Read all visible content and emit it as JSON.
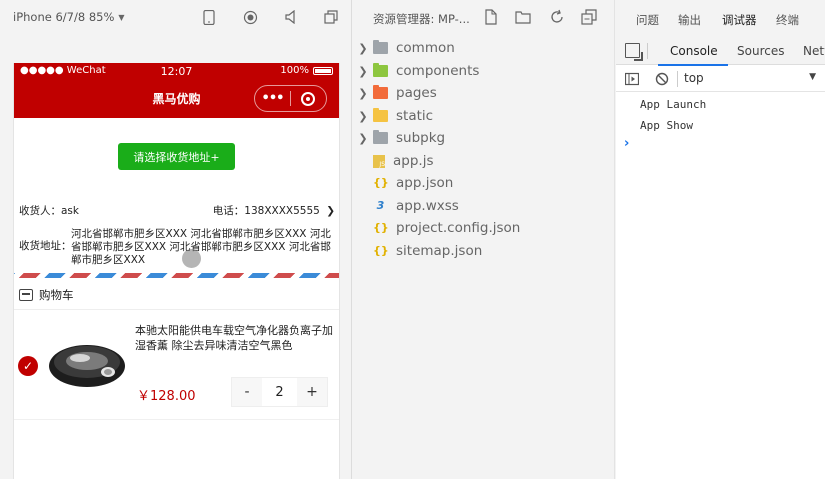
{
  "simulator": {
    "device": "iPhone 6/7/8 85%",
    "status": {
      "carrier": "●●●●● WeChat",
      "time": "12:07",
      "battery": "100%"
    },
    "nav_title": "黑马优购",
    "capsule_dots": "•••",
    "choose_address_button": "请选择收货地址+",
    "receiver_label": "收货人：ask",
    "phone_label": "电话：138XXXX5555",
    "address_label": "收货地址：",
    "address_value": "河北省邯郸市肥乡区XXX 河北省邯郸市肥乡区XXX 河北省邯郸市肥乡区XXX 河北省邯郸市肥乡区XXX 河北省邯郸市肥乡区XXX",
    "cart_title": "购物车",
    "goods": {
      "name": "本驰太阳能供电车载空气净化器负离子加湿香薰 除尘去异味清洁空气黑色",
      "price": "￥128.00",
      "count": "2",
      "minus": "-",
      "plus": "+"
    }
  },
  "explorer": {
    "title": "资源管理器: MP-...",
    "items": [
      {
        "name": "common",
        "type": "folder",
        "color": "#9ea4aa"
      },
      {
        "name": "components",
        "type": "folder",
        "color": "#8dc63f"
      },
      {
        "name": "pages",
        "type": "folder",
        "color": "#f26b3a"
      },
      {
        "name": "static",
        "type": "folder",
        "color": "#f5c342"
      },
      {
        "name": "subpkg",
        "type": "folder",
        "color": "#9ea4aa"
      },
      {
        "name": "app.js",
        "type": "js"
      },
      {
        "name": "app.json",
        "type": "json"
      },
      {
        "name": "app.wxss",
        "type": "css"
      },
      {
        "name": "project.config.json",
        "type": "json"
      },
      {
        "name": "sitemap.json",
        "type": "json"
      }
    ]
  },
  "debug": {
    "tabs": [
      "问题",
      "输出",
      "调试器",
      "终端"
    ],
    "active_tab": "调试器",
    "devtools_tabs": [
      "Console",
      "Sources",
      "Netw"
    ],
    "context": "top",
    "logs": [
      "App Launch",
      "App Show"
    ],
    "prompt": "›"
  },
  "colors": {
    "brand_red": "#c00000",
    "wx_green": "#1aad19",
    "devtools_blue": "#1a73e8"
  }
}
